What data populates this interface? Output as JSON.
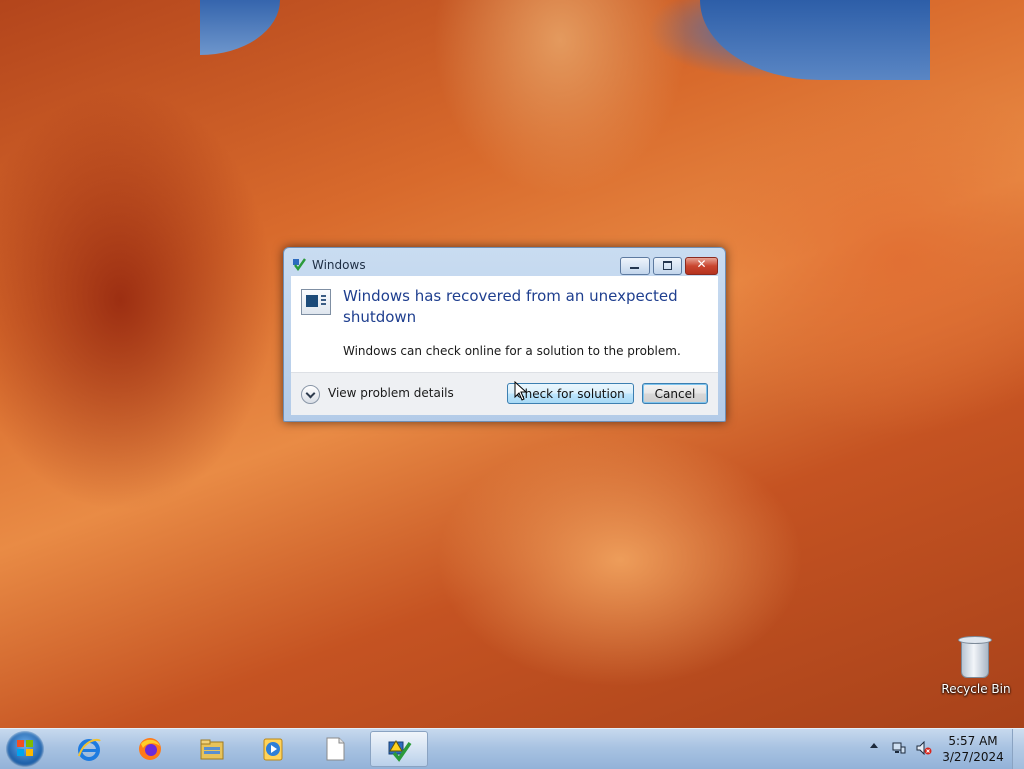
{
  "dialog": {
    "title": "Windows",
    "heading": "Windows has recovered from an unexpected shutdown",
    "subtext": "Windows can check online for a solution to the problem.",
    "details_label": "View problem details",
    "check_button": "Check for solution",
    "cancel_button": "Cancel"
  },
  "desktop": {
    "recycle_bin_label": "Recycle Bin"
  },
  "taskbar": {
    "apps": [
      {
        "name": "internet-explorer-icon"
      },
      {
        "name": "firefox-icon"
      },
      {
        "name": "file-explorer-icon"
      },
      {
        "name": "media-player-icon"
      },
      {
        "name": "blank-document-icon"
      },
      {
        "name": "problem-reports-icon",
        "active": true
      }
    ],
    "time": "5:57 AM",
    "date": "3/27/2024"
  }
}
